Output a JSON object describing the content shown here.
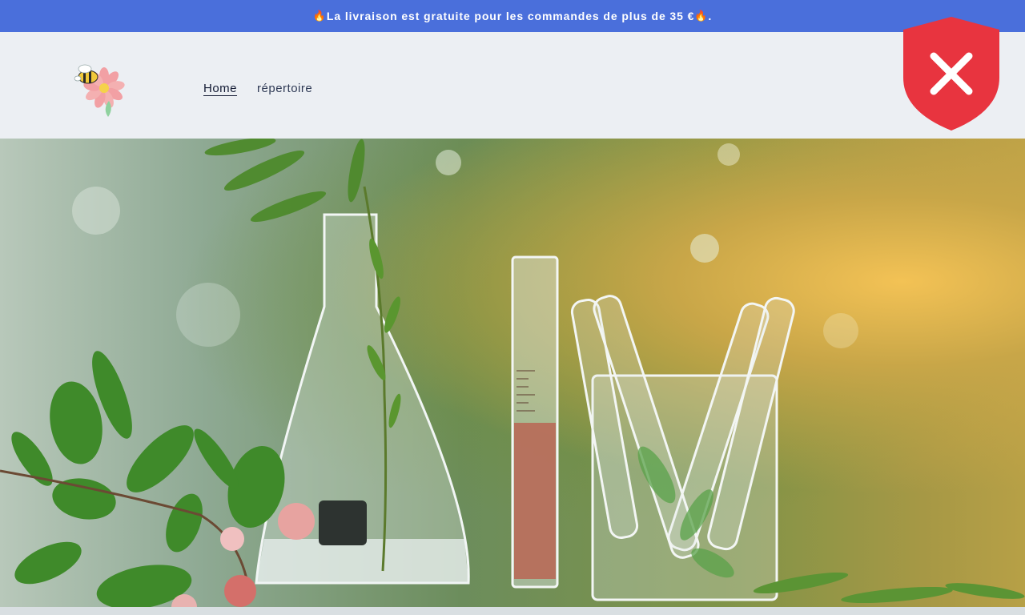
{
  "announcement": {
    "text": "La livraison est gratuite pour les commandes de plus de 35 €",
    "emoji": "🔥",
    "suffix": "."
  },
  "header": {
    "logo_icon": "bee-flower-logo",
    "nav": [
      {
        "label": "Home",
        "active": true
      },
      {
        "label": "répertoire",
        "active": false
      }
    ]
  },
  "badge": {
    "icon": "shield-close-icon",
    "color": "#e8343f"
  },
  "hero": {
    "image_icon": "lab-glassware-plants-image"
  },
  "colors": {
    "announcement_bg": "#4a6fdb",
    "header_bg": "#eceff3",
    "badge_red": "#e8343f"
  }
}
